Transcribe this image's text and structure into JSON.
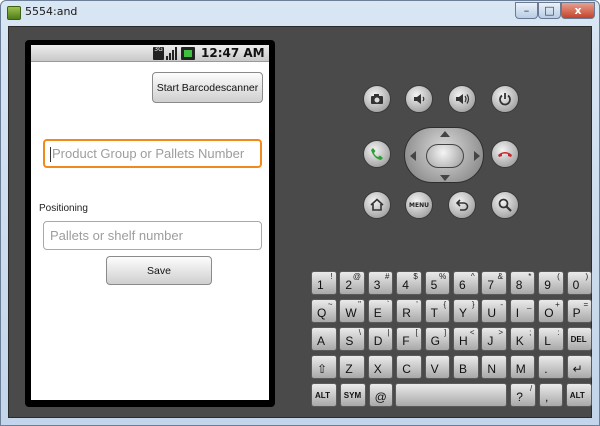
{
  "window": {
    "title": "5554:and",
    "minimize": "–",
    "maximize": "□",
    "close": "x"
  },
  "statusbar": {
    "network": "3G",
    "time": "12:47 AM"
  },
  "app": {
    "start_button": "Start Barcodescanner",
    "group_placeholder": "Product Group or Pallets Number",
    "positioning_label": "Positioning",
    "pos_placeholder": "Pallets or shelf number",
    "save_button": "Save"
  },
  "controls": {
    "top_row": [
      "camera-icon",
      "volume-down-icon",
      "volume-up-icon",
      "power-icon"
    ],
    "mid_row": [
      "call-icon",
      "dpad",
      "end-call-icon"
    ],
    "bottom_row": [
      "home-icon",
      "menu-button",
      "back-icon",
      "search-icon"
    ],
    "menu_label": "MENU"
  },
  "keyboard": {
    "rows": [
      [
        [
          "1",
          "!"
        ],
        [
          "2",
          "@"
        ],
        [
          "3",
          "#"
        ],
        [
          "4",
          "$"
        ],
        [
          "5",
          "%"
        ],
        [
          "6",
          "^"
        ],
        [
          "7",
          "&"
        ],
        [
          "8",
          "*"
        ],
        [
          "9",
          "("
        ],
        [
          "0",
          ")"
        ]
      ],
      [
        [
          "Q",
          "~"
        ],
        [
          "W",
          "\""
        ],
        [
          "E",
          "`"
        ],
        [
          "R",
          "'"
        ],
        [
          "T",
          "{"
        ],
        [
          "Y",
          "}"
        ],
        [
          "U",
          "-"
        ],
        [
          "I",
          "_"
        ],
        [
          "O",
          "+"
        ],
        [
          "P",
          "="
        ]
      ],
      [
        [
          "A",
          ""
        ],
        [
          "S",
          "\\"
        ],
        [
          "D",
          "|"
        ],
        [
          "F",
          "["
        ],
        [
          "G",
          "]"
        ],
        [
          "H",
          "<"
        ],
        [
          "J",
          ">"
        ],
        [
          "K",
          ";"
        ],
        [
          "L",
          ":"
        ],
        [
          "DEL",
          ""
        ]
      ],
      [
        [
          "⇧",
          ""
        ],
        [
          "Z",
          ""
        ],
        [
          "X",
          ""
        ],
        [
          "C",
          ""
        ],
        [
          "V",
          ""
        ],
        [
          "B",
          ""
        ],
        [
          "N",
          ""
        ],
        [
          "M",
          ""
        ],
        [
          ".",
          ""
        ],
        [
          "↵",
          ""
        ]
      ],
      [
        [
          "ALT",
          ""
        ],
        [
          "SYM",
          ""
        ],
        [
          "@",
          ""
        ],
        [
          "SPACE",
          ""
        ],
        [
          "?",
          "/"
        ],
        [
          ",",
          ""
        ],
        [
          "ALT",
          ""
        ]
      ]
    ]
  },
  "colors": {
    "focus": "#f28a1b",
    "call_green": "#2e9e3a",
    "end_red": "#c8242a"
  }
}
